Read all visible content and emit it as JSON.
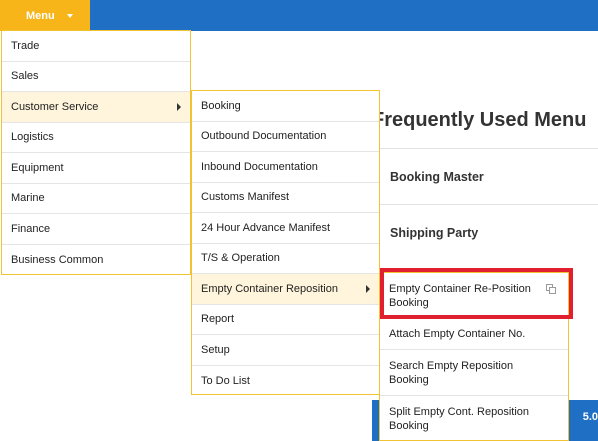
{
  "header": {
    "menu_label": "Menu"
  },
  "background": {
    "frequently_used_title": "Frequently Used Menu",
    "favorites": [
      "Booking Master",
      "Shipping Party"
    ],
    "partial_text": "5.0"
  },
  "menu_level1": [
    "Trade",
    "Sales",
    "Customer Service",
    "Logistics",
    "Equipment",
    "Marine",
    "Finance",
    "Business Common"
  ],
  "menu_level2": [
    "Booking",
    "Outbound Documentation",
    "Inbound Documentation",
    "Customs Manifest",
    "24 Hour Advance Manifest",
    "T/S & Operation",
    "Empty Container Reposition",
    "Report",
    "Setup",
    "To Do List"
  ],
  "menu_level3": [
    "Empty Container Re-Position Booking",
    "Attach Empty Container No.",
    "Search Empty Reposition Booking",
    "Split Empty Cont. Reposition Booking"
  ],
  "colors": {
    "topbar": "#1f6fc5",
    "menu_button": "#f7b519",
    "panel_border": "#f1c232",
    "active_item": "#fff5dc",
    "highlight": "#e0202f"
  }
}
